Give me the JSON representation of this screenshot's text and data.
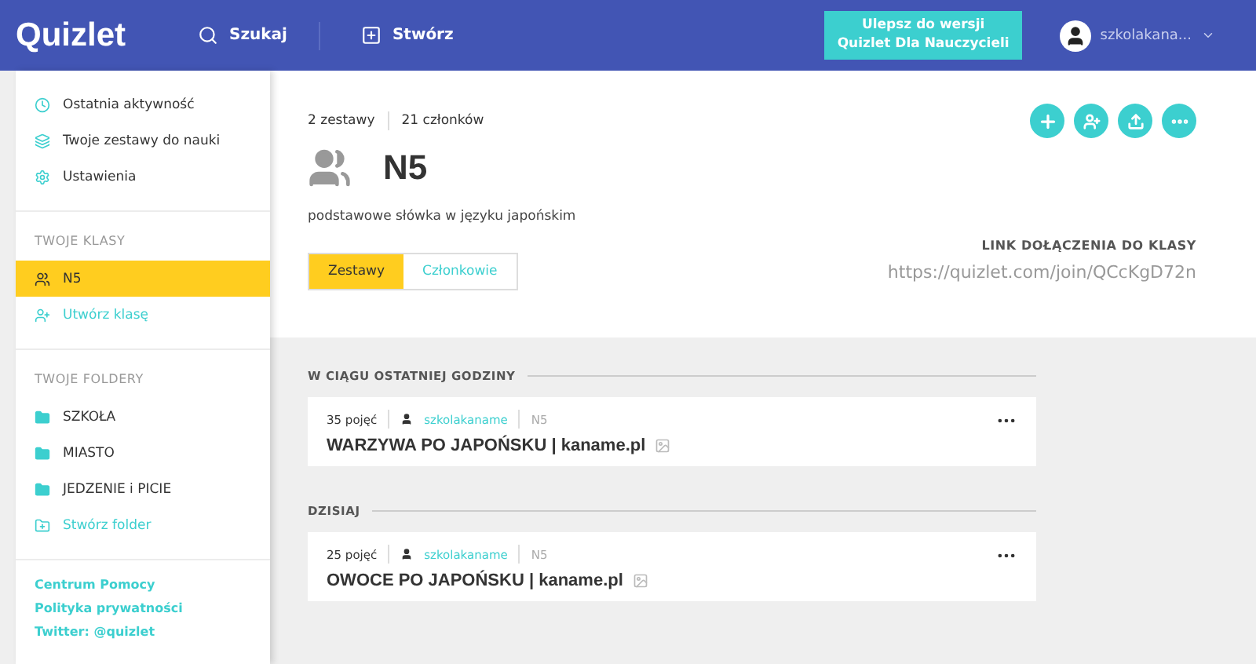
{
  "header": {
    "logo": "Quizlet",
    "nav": [
      {
        "kind": "search",
        "label": "Szukaj"
      },
      {
        "kind": "create",
        "label": "Stwórz"
      }
    ],
    "upgrade": [
      "Ulepsz do wersji",
      "Quizlet Dla Nauczycieli"
    ],
    "user": "szkolakana..."
  },
  "sidebar": {
    "top": [
      {
        "kind": "clock",
        "label": "Ostatnia aktywność"
      },
      {
        "kind": "sets",
        "label": "Twoje zestawy do nauki"
      },
      {
        "kind": "gear",
        "label": "Ustawienia"
      }
    ],
    "classes_heading": "TWOJE KLASY",
    "classes": [
      {
        "kind": "class",
        "label": "N5",
        "selected": true
      },
      {
        "kind": "add",
        "label": "Utwórz klasę",
        "selected": false
      }
    ],
    "folders_heading": "TWOJE FOLDERY",
    "folders": [
      {
        "kind": "folder",
        "label": "SZKOŁA"
      },
      {
        "kind": "folder",
        "label": "MIASTO"
      },
      {
        "kind": "folder",
        "label": "JEDZENIE i PICIE"
      },
      {
        "kind": "add",
        "label": "Stwórz folder"
      }
    ],
    "links": [
      "Centrum Pomocy",
      "Polityka prywatności",
      "Twitter: @quizlet"
    ]
  },
  "class": {
    "stats": [
      "2 zestawy",
      "21 członków"
    ],
    "title": "N5",
    "description": "podstawowe słówka w języku japońskim",
    "tabs": [
      {
        "label": "Zestawy",
        "selected": true
      },
      {
        "label": "Członkowie",
        "selected": false
      }
    ],
    "actions": [
      {
        "kind": "plus"
      },
      {
        "kind": "add-member"
      },
      {
        "kind": "upload"
      },
      {
        "kind": "more"
      }
    ],
    "join_label": "LINK DOŁĄCZENIA DO KLASY",
    "join_url": "https://quizlet.com/join/QCcKgD72n"
  },
  "sections": [
    {
      "heading": "W CIĄGU OSTATNIEJ GODZINY",
      "sets": [
        {
          "terms": "35 pojęć",
          "author": "szkolakaname",
          "class": "N5",
          "title": "WARZYWA PO JAPOŃSKU | kaname.pl"
        }
      ]
    },
    {
      "heading": "DZISIAJ",
      "sets": [
        {
          "terms": "25 pojęć",
          "author": "szkolakaname",
          "class": "N5",
          "title": "OWOCE PO JAPOŃSKU | kaname.pl"
        }
      ]
    }
  ]
}
